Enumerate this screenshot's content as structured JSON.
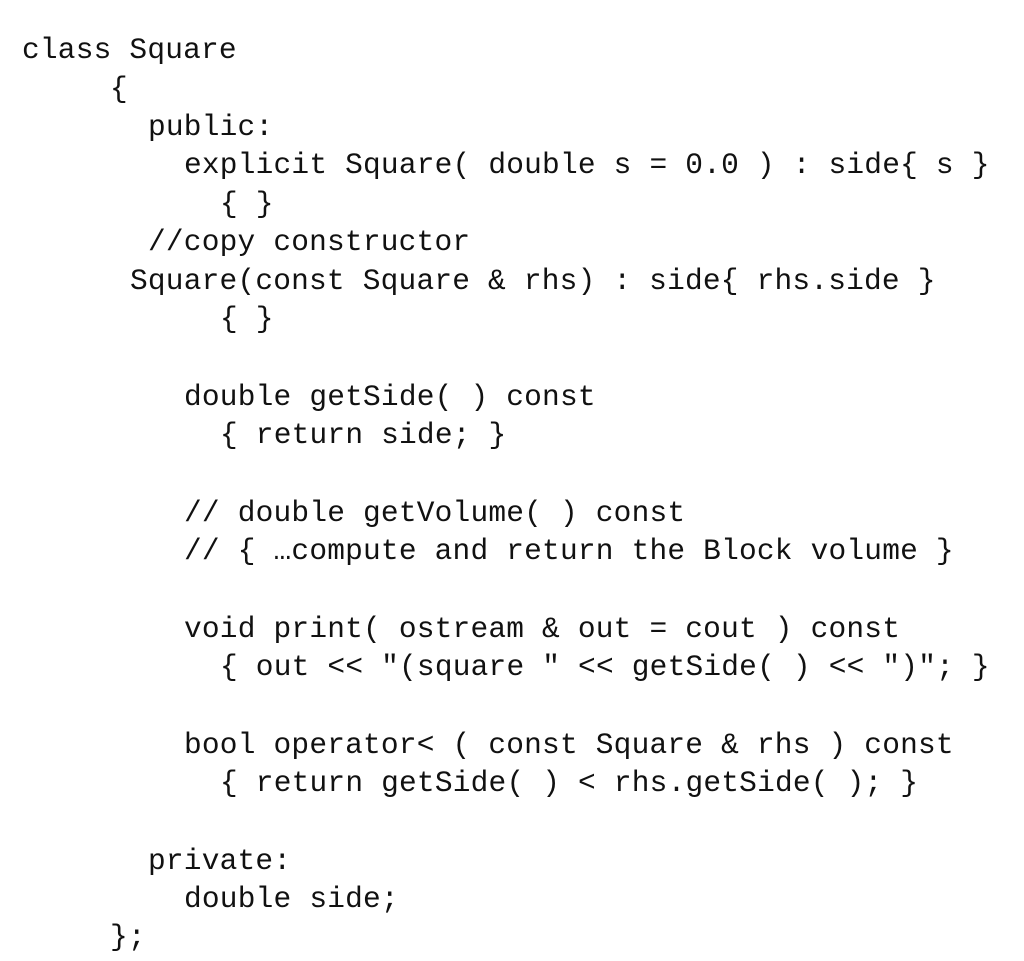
{
  "document": {
    "language": "C++",
    "lines": [
      "class Square",
      "{",
      "public:",
      "explicit Square( double s = 0.0 ) : side{ s }",
      "{ }",
      "//copy constructor",
      "Square(const Square & rhs) : side{ rhs.side }",
      "{ }",
      "",
      "double getSide( ) const",
      "{ return side; }",
      "",
      "// double getVolume( ) const",
      "// { …compute and return the Block volume }",
      "",
      "void print( ostream & out = cout ) const",
      "{ out << \"(square \" << getSide( ) << \")\"; }",
      "",
      "bool operator< ( const Square & rhs ) const",
      "{ return getSide( ) < rhs.getSide( ); }",
      "",
      "private:",
      "double side;",
      "};"
    ]
  }
}
